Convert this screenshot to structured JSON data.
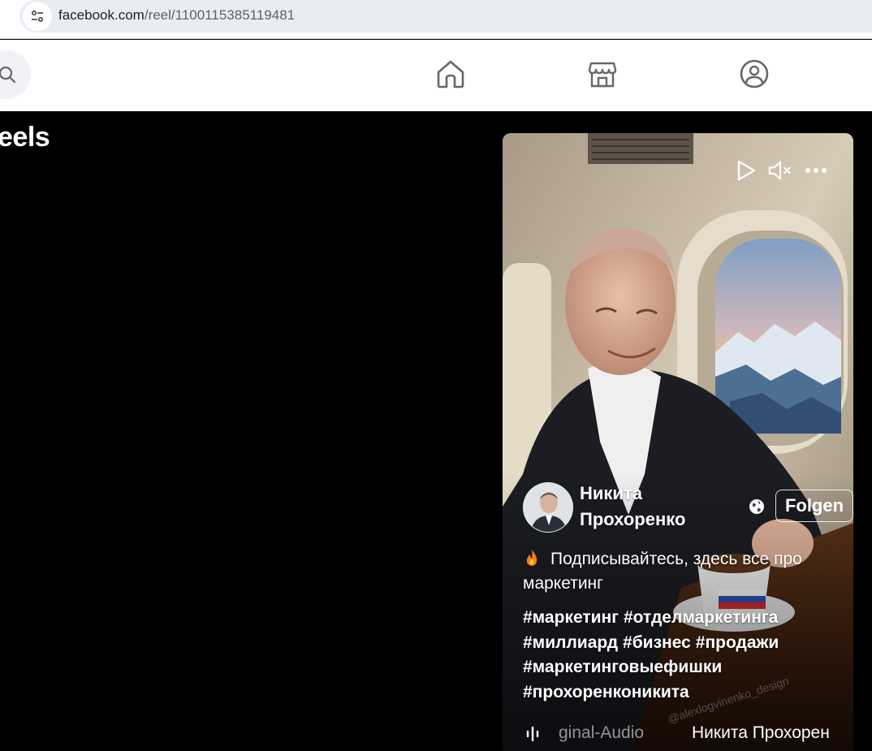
{
  "browser": {
    "url_domain": "facebook.com",
    "url_path": "/reel/1100115385119481"
  },
  "nav": {
    "icons": [
      "search-icon",
      "home-icon",
      "marketplace-icon",
      "groups-icon"
    ]
  },
  "page": {
    "title": "eels"
  },
  "reel": {
    "author": "Никита Прохоренко",
    "follow_label": "Folgen",
    "caption": "Подписывайтесь, здесь все про маркетинг",
    "hashtags": [
      "#маркетинг",
      "#отделмаркетинга",
      "#миллиард",
      "#бизнес",
      "#продажи",
      "#маркетинговыефишки",
      "#прохоренконикита"
    ],
    "audio_title": "ginal-Audio",
    "audio_artist": "Никита Прохорен",
    "watermark": "@alexlogvinenko_design"
  },
  "colors": {
    "fb_nav_bg": "#ffffff",
    "page_bg": "#000000",
    "icon_gray": "#65676b"
  }
}
